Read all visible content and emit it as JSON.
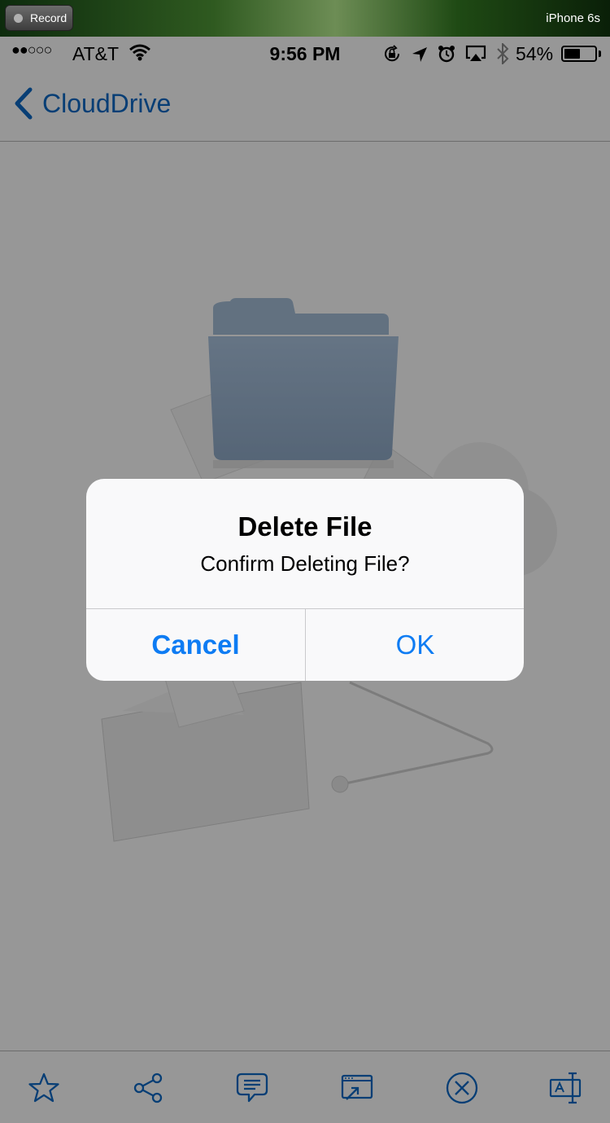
{
  "recorder": {
    "record_label": "Record",
    "device_name": "iPhone 6s"
  },
  "status_bar": {
    "signal": "●●○○○",
    "carrier": "AT&T",
    "time": "9:56 PM",
    "battery_percent": "54%",
    "battery_level": 0.54,
    "icons": [
      "signal-dots-icon",
      "wifi-icon",
      "orientation-lock-icon",
      "location-icon",
      "alarm-icon",
      "airplay-icon",
      "bluetooth-icon",
      "battery-icon"
    ]
  },
  "nav": {
    "back_label": "CloudDrive"
  },
  "dialog": {
    "title": "Delete File",
    "message": "Confirm Deleting File?",
    "cancel_label": "Cancel",
    "ok_label": "OK"
  },
  "toolbar": {
    "icons": [
      "star-icon",
      "share-icon",
      "comment-icon",
      "cast-icon",
      "close-circle-icon",
      "rename-icon"
    ]
  },
  "colors": {
    "accent": "#0e7cf3",
    "dim_overlay": "rgba(0,0,0,0.40)",
    "alert_bg": "#f9f9fa"
  }
}
